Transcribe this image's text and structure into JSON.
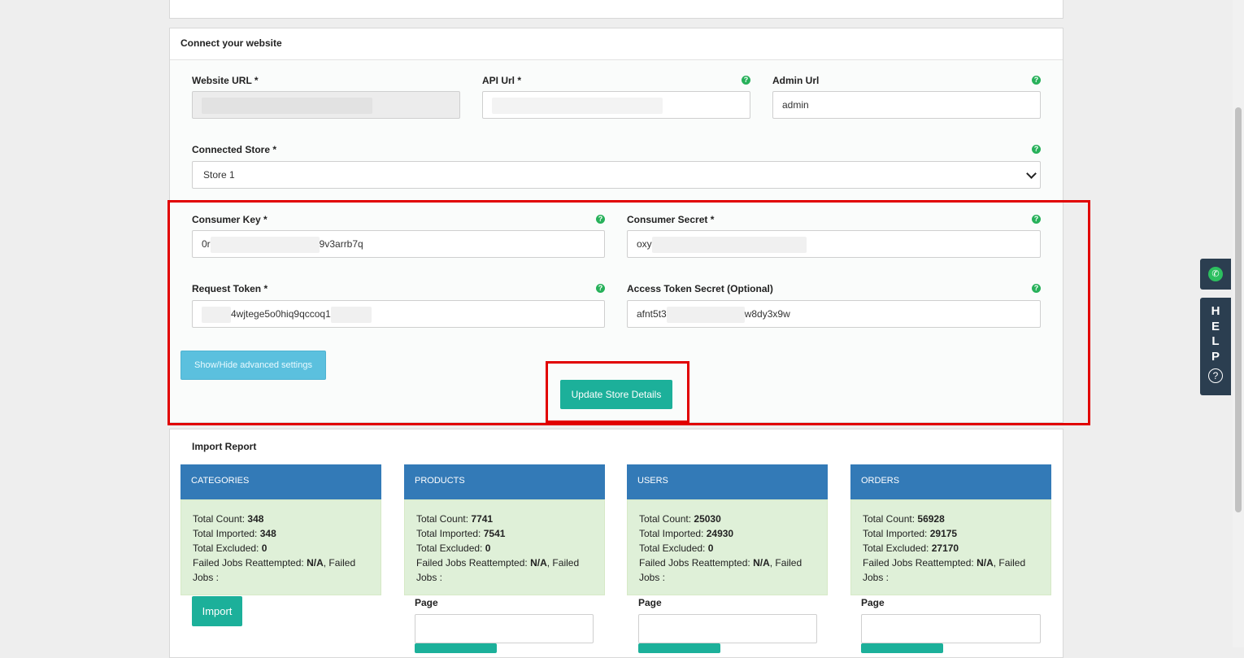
{
  "connect": {
    "title": "Connect your website",
    "website_url_label": "Website URL *",
    "api_url_label": "API Url *",
    "admin_url_label": "Admin Url",
    "admin_url_value": "admin",
    "connected_store_label": "Connected Store *",
    "connected_store_value": "Store 1",
    "consumer_key_label": "Consumer Key *",
    "consumer_key_value_start": "0r",
    "consumer_key_value_end": "9v3arrb7q",
    "consumer_secret_label": "Consumer Secret *",
    "consumer_secret_value_start": "oxy",
    "request_token_label": "Request Token *",
    "request_token_value": "4wjtege5o0hiq9qccoq1",
    "access_token_label": "Access Token Secret (Optional)",
    "access_token_value_start": "afnt5t3",
    "access_token_value_end": "w8dy3x9w",
    "advanced_button": "Show/Hide advanced settings",
    "update_button": "Update Store Details",
    "help_glyph": "?"
  },
  "report": {
    "title": "Import Report",
    "labels": {
      "total_count": "Total Count:",
      "total_imported": "Total Imported:",
      "total_excluded": "Total Excluded:",
      "failed_reattempted": "Failed Jobs Reattempted:",
      "failed_jobs": ", Failed Jobs :"
    },
    "cards": [
      {
        "name": "CATEGORIES",
        "total_count": "348",
        "total_imported": "348",
        "total_excluded": "0",
        "failed_reattempted": "N/A"
      },
      {
        "name": "PRODUCTS",
        "total_count": "7741",
        "total_imported": "7541",
        "total_excluded": "0",
        "failed_reattempted": "N/A"
      },
      {
        "name": "USERS",
        "total_count": "25030",
        "total_imported": "24930",
        "total_excluded": "0",
        "failed_reattempted": "N/A"
      },
      {
        "name": "ORDERS",
        "total_count": "56928",
        "total_imported": "29175",
        "total_excluded": "27170",
        "failed_reattempted": "N/A"
      }
    ],
    "import_button": "Import",
    "page_label": "Page"
  },
  "side": {
    "phone_icon": "phone-icon",
    "help_letters": [
      "H",
      "E",
      "L",
      "P"
    ],
    "help_glyph": "?"
  },
  "colors": {
    "highlight": "#e10000",
    "teal_button": "#1cb09a",
    "card_header": "#337ab7",
    "card_body": "#dff0d8",
    "info_button": "#5bc0de"
  }
}
